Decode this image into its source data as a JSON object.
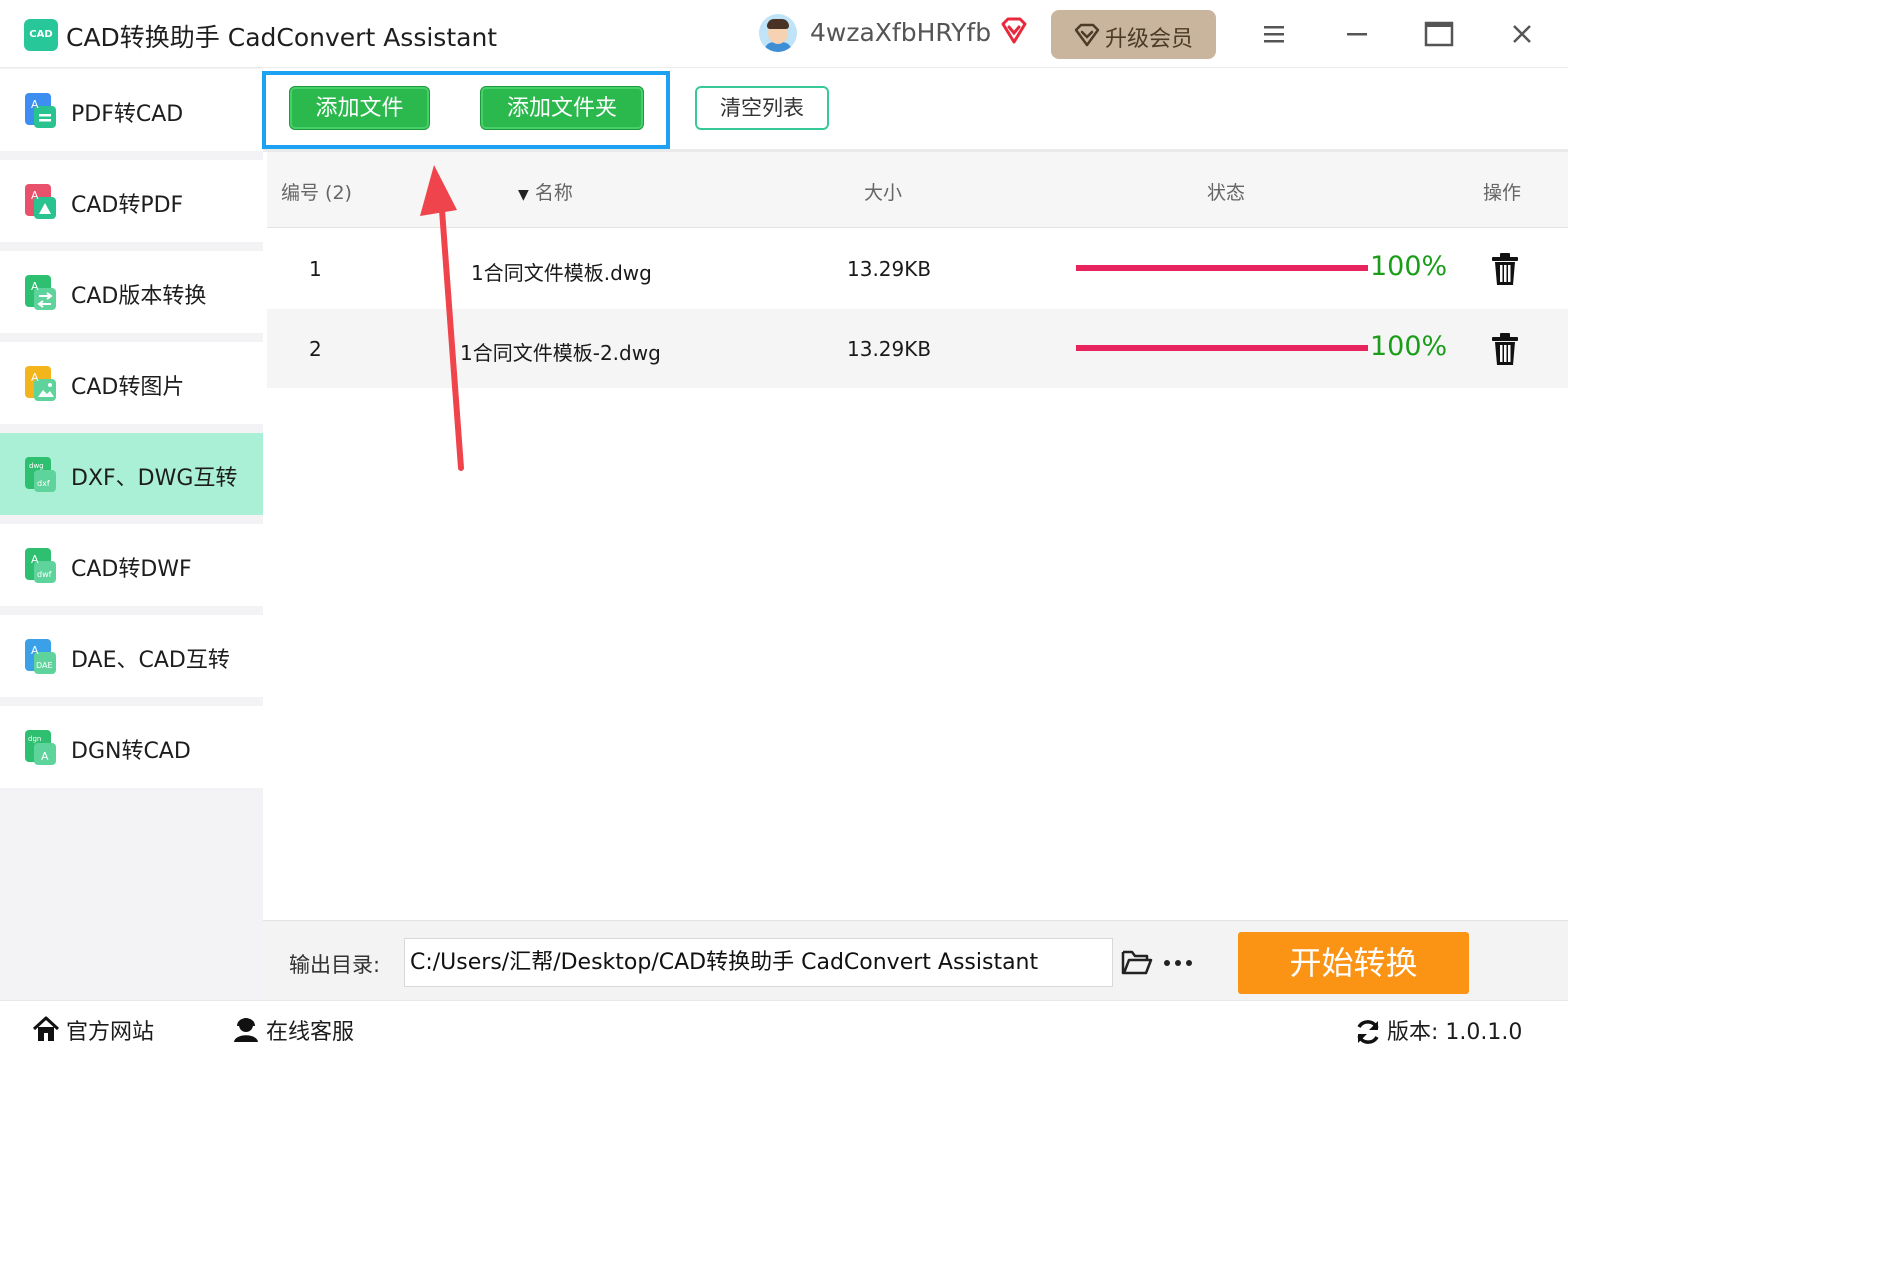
{
  "app": {
    "logo_text": "CAD",
    "title": "CAD转换助手 CadConvert Assistant",
    "username": "4wzaXfbHRYfb",
    "upgrade_label": "升级会员"
  },
  "sidebar": {
    "items": [
      {
        "label": "PDF转CAD",
        "icon": "pdf-to-cad-icon",
        "color": "#3c8ef0"
      },
      {
        "label": "CAD转PDF",
        "icon": "cad-to-pdf-icon",
        "color": "#e9506b"
      },
      {
        "label": "CAD版本转换",
        "icon": "cad-version-icon",
        "color": "#2fbf71"
      },
      {
        "label": "CAD转图片",
        "icon": "cad-to-image-icon",
        "color": "#f3b51b"
      },
      {
        "label": "DXF、DWG互转",
        "icon": "dxf-dwg-icon",
        "color": "#2fbf71",
        "active": true
      },
      {
        "label": "CAD转DWF",
        "icon": "cad-to-dwf-icon",
        "color": "#2fbf71"
      },
      {
        "label": "DAE、CAD互转",
        "icon": "dae-cad-icon",
        "color": "#3aa0e8"
      },
      {
        "label": "DGN转CAD",
        "icon": "dgn-to-cad-icon",
        "color": "#2fbf71"
      }
    ]
  },
  "toolbar": {
    "add_file": "添加文件",
    "add_folder": "添加文件夹",
    "clear_list": "清空列表"
  },
  "table": {
    "headers": {
      "index": "编号 (2)",
      "name": "名称",
      "size": "大小",
      "status": "状态",
      "action": "操作"
    },
    "rows": [
      {
        "index": "1",
        "name": "1合同文件模板.dwg",
        "size": "13.29KB",
        "progress": 1.0,
        "progress_text": "100%"
      },
      {
        "index": "2",
        "name": "1合同文件模板-2.dwg",
        "size": "13.29KB",
        "progress": 1.0,
        "progress_text": "100%"
      }
    ]
  },
  "output": {
    "label": "输出目录:",
    "path": "C:/Users/汇帮/Desktop/CAD转换助手 CadConvert Assistant",
    "start_label": "开始转换"
  },
  "footer": {
    "website": "官方网站",
    "support": "在线客服",
    "version": "版本: 1.0.1.0"
  },
  "colors": {
    "accent_green": "#2bb84d",
    "active_nav": "#aaf0d6",
    "progress": "#e8245e",
    "percent_text": "#1a9e1a",
    "start_button": "#fb9415",
    "highlight_box": "#1da1f2",
    "annotation_arrow": "#f0444c"
  }
}
